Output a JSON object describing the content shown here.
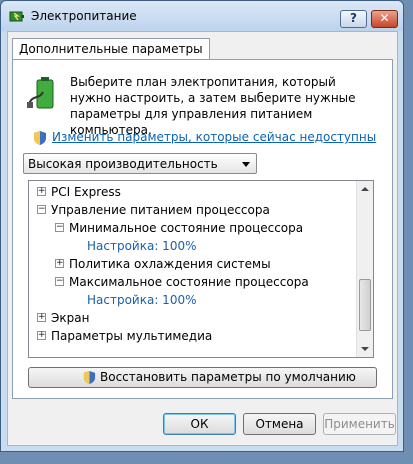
{
  "window": {
    "title": "Электропитание",
    "help_label": "?",
    "close_label": "✕"
  },
  "tab": {
    "label": "Дополнительные параметры"
  },
  "panel": {
    "description": "Выберите план электропитания, который нужно настроить, а затем выберите нужные параметры для управления питанием компьютера.",
    "change_link": "Изменить параметры, которые сейчас недоступны",
    "plan_select_value": "Высокая производительность"
  },
  "tree": {
    "items": [
      {
        "expander": "+",
        "label": "PCI Express"
      },
      {
        "expander": "−",
        "label": "Управление питанием процессора"
      },
      {
        "expander": "−",
        "label": "Минимальное состояние процессора"
      },
      {
        "expander": "",
        "label": "Настройка: 100%"
      },
      {
        "expander": "+",
        "label": "Политика охлаждения системы"
      },
      {
        "expander": "−",
        "label": "Максимальное состояние процессора"
      },
      {
        "expander": "",
        "label": "Настройка: 100%"
      },
      {
        "expander": "+",
        "label": "Экран"
      },
      {
        "expander": "+",
        "label": "Параметры мультимедиа"
      }
    ]
  },
  "buttons": {
    "restore": "Восстановить параметры по умолчанию",
    "ok": "ОК",
    "cancel": "Отмена",
    "apply": "Применить"
  },
  "colors": {
    "link": "#0a63b6",
    "setting_value": "#1d5fa8"
  }
}
